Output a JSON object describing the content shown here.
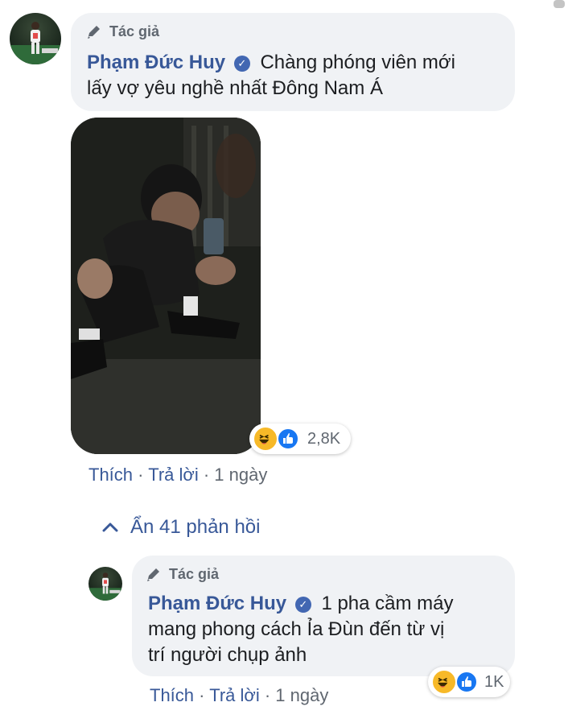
{
  "comment": {
    "author_badge": "Tác giả",
    "author_name": "Phạm Đức Huy",
    "text_line1": "Chàng phóng viên mới",
    "text_line2": "lấy vợ yêu nghề nhất Đông Nam Á",
    "reaction_count": "2,8K",
    "actions": {
      "like": "Thích",
      "reply": "Trả lời",
      "time": "1 ngày",
      "separator": "·"
    }
  },
  "replies_toggle": {
    "label": "Ẩn 41 phản hồi",
    "icon": "chevron-up-icon"
  },
  "reply": {
    "author_badge": "Tác giả",
    "author_name": "Phạm Đức Huy",
    "text_line1": "1 pha cầm máy",
    "text_line2": "mang phong cách Ỉa Đùn đến từ vị",
    "text_line3": "trí người chụp ảnh",
    "reaction_count": "1K",
    "actions": {
      "like": "Thích",
      "reply": "Trả lời",
      "time": "1 ngày",
      "separator": "·"
    }
  },
  "colors": {
    "link_blue": "#385898",
    "bubble_bg": "#f0f2f5",
    "verified_blue": "#4267b2",
    "like_blue": "#1877f2",
    "haha_yellow": "#f7b928",
    "meta_gray": "#606770"
  }
}
